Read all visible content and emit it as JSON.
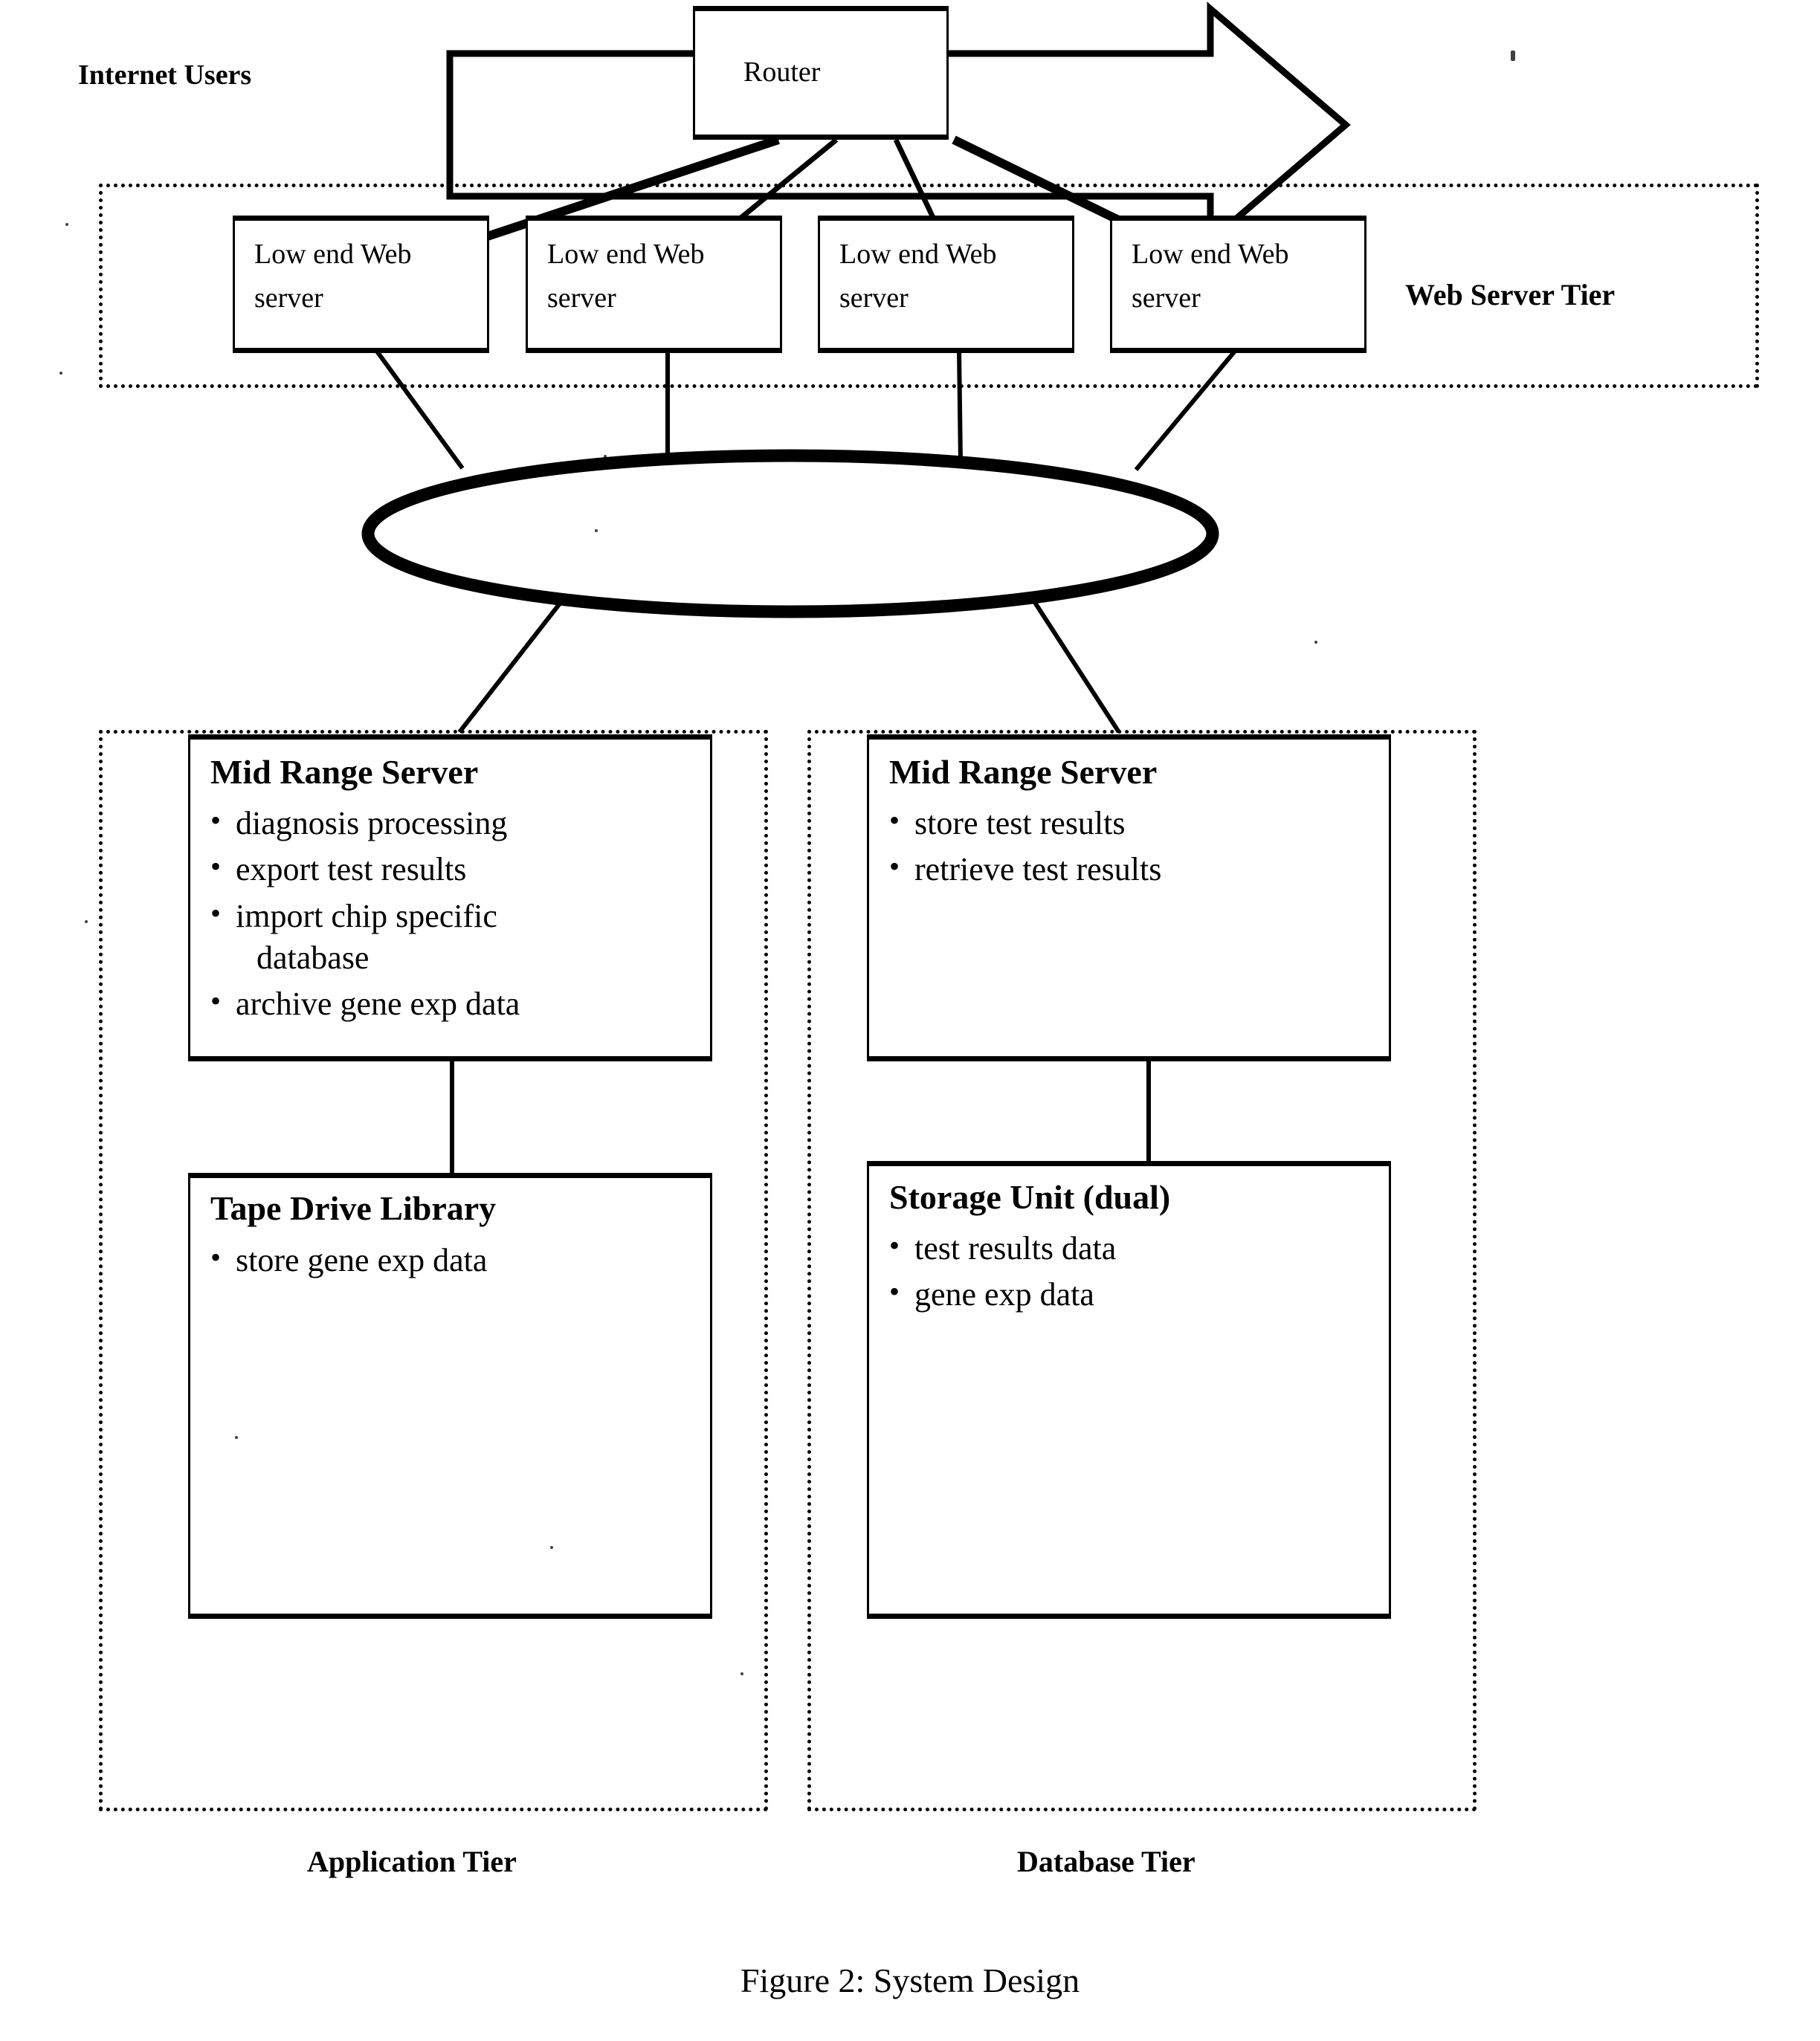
{
  "figure": {
    "caption": "Figure 2:  System Design"
  },
  "internet": {
    "label": "Internet Users",
    "arrow_icon": "right-arrow-icon"
  },
  "router": {
    "label": "Router"
  },
  "web_server_tier": {
    "label": "Web Server Tier",
    "servers": [
      {
        "line1": "Low end Web",
        "line2": "server"
      },
      {
        "line1": "Low end Web",
        "line2": "server"
      },
      {
        "line1": "Low end Web",
        "line2": "server"
      },
      {
        "line1": "Low end Web",
        "line2": "server"
      }
    ]
  },
  "network": {
    "shape": "ellipse",
    "label": ""
  },
  "application_tier": {
    "label": "Application Tier",
    "mid_range_server": {
      "title": "Mid Range Server",
      "bullets": [
        "diagnosis processing",
        "export test results",
        "import chip specific",
        "database",
        "archive gene exp data"
      ]
    },
    "tape_drive_library": {
      "title": "Tape Drive Library",
      "bullets": [
        "store gene exp data"
      ]
    }
  },
  "database_tier": {
    "label": "Database Tier",
    "mid_range_server": {
      "title": "Mid Range Server",
      "bullets": [
        "store test results",
        "retrieve test results"
      ]
    },
    "storage_unit": {
      "title": "Storage Unit (dual)",
      "bullets": [
        "test results data",
        "gene exp data"
      ],
      "disk_count": 2
    }
  },
  "colors": {
    "ink": "#000000",
    "paper": "#ffffff"
  }
}
